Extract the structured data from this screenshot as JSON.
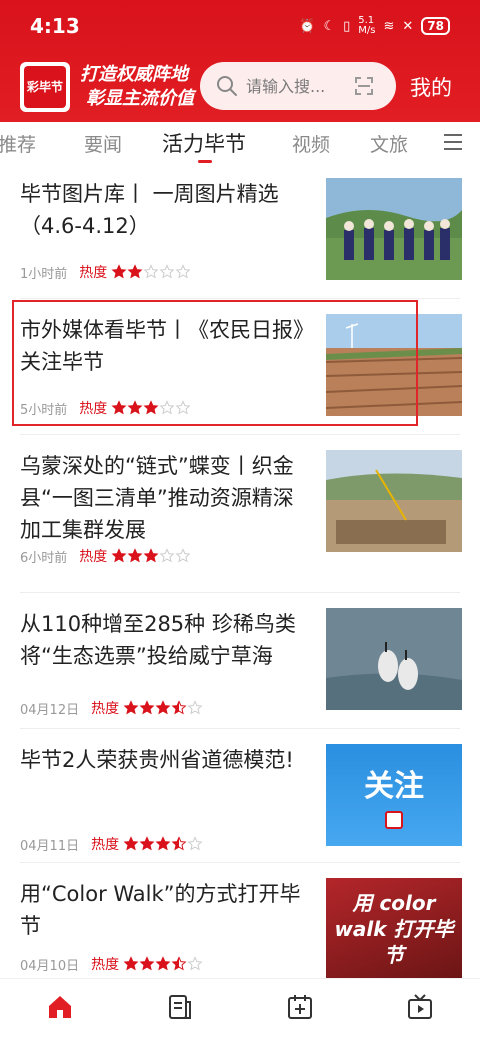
{
  "status": {
    "time": "4:13",
    "speed": "5.1\nM/s",
    "battery": "78"
  },
  "header": {
    "logo_text": "彩毕节",
    "slogan_line1": "打造权威阵地",
    "slogan_line2": "彰显主流价值",
    "search_placeholder": "请输入搜...",
    "mine_label": "我的"
  },
  "tabs": [
    {
      "label": "推荐"
    },
    {
      "label": "要闻"
    },
    {
      "label": "活力毕节",
      "active": true
    },
    {
      "label": "视频"
    },
    {
      "label": "文旅"
    }
  ],
  "articles": [
    {
      "title": "毕节图片库丨 一周图片精选（4.6-4.12）",
      "time": "1小时前",
      "heat_label": "热度",
      "stars": 2
    },
    {
      "title": "市外媒体看毕节丨《农民日报》关注毕节",
      "time": "5小时前",
      "heat_label": "热度",
      "stars": 3
    },
    {
      "title": "乌蒙深处的“链式”蝶变丨织金县“一图三清单”推动资源精深加工集群发展",
      "time": "6小时前",
      "heat_label": "热度",
      "stars": 3
    },
    {
      "title": "从110种增至285种 珍稀鸟类将“生态选票”投给威宁草海",
      "time": "04月12日",
      "heat_label": "热度",
      "stars": 3.5
    },
    {
      "title": "毕节2人荣获贵州省道德模范!",
      "time": "04月11日",
      "heat_label": "热度",
      "stars": 3.5,
      "thumb_text": "关注"
    },
    {
      "title": "用“Color Walk”的方式打开毕节",
      "time": "04月10日",
      "heat_label": "热度",
      "stars": 3.5,
      "thumb_text": "用 color walk 打开毕节"
    }
  ],
  "colors": {
    "brand_red": "#e11e23",
    "star_red": "#d9121b",
    "highlight": "#e0262b"
  }
}
